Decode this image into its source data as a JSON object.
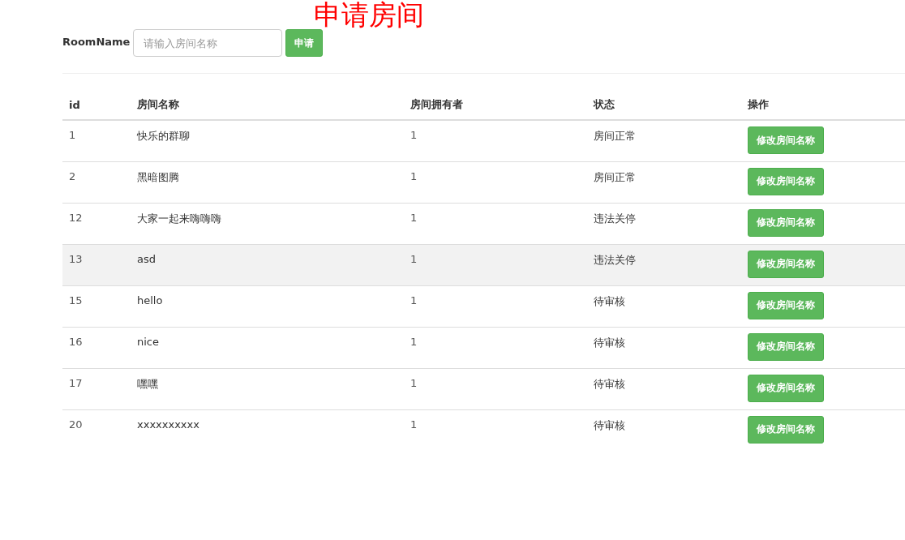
{
  "heading": "申请房间",
  "form": {
    "label": "RoomName",
    "placeholder": "请输入房间名称",
    "submit": "申请"
  },
  "table": {
    "columns": [
      "id",
      "房间名称",
      "房间拥有者",
      "状态",
      "操作"
    ],
    "rows": [
      {
        "id": "1",
        "name": "快乐的群聊",
        "owner": "1",
        "status": "房间正常",
        "action": "修改房间名称",
        "hovered": false
      },
      {
        "id": "2",
        "name": "黑暗图腾",
        "owner": "1",
        "status": "房间正常",
        "action": "修改房间名称",
        "hovered": false
      },
      {
        "id": "12",
        "name": "大家一起来嗨嗨嗨",
        "owner": "1",
        "status": "违法关停",
        "action": "修改房间名称",
        "hovered": false
      },
      {
        "id": "13",
        "name": "asd",
        "owner": "1",
        "status": "违法关停",
        "action": "修改房间名称",
        "hovered": true
      },
      {
        "id": "15",
        "name": "hello",
        "owner": "1",
        "status": "待审核",
        "action": "修改房间名称",
        "hovered": false
      },
      {
        "id": "16",
        "name": "nice",
        "owner": "1",
        "status": "待审核",
        "action": "修改房间名称",
        "hovered": false
      },
      {
        "id": "17",
        "name": "嘿嘿",
        "owner": "1",
        "status": "待审核",
        "action": "修改房间名称",
        "hovered": false
      },
      {
        "id": "20",
        "name": "xxxxxxxxxx",
        "owner": "1",
        "status": "待审核",
        "action": "修改房间名称",
        "hovered": false
      }
    ]
  }
}
